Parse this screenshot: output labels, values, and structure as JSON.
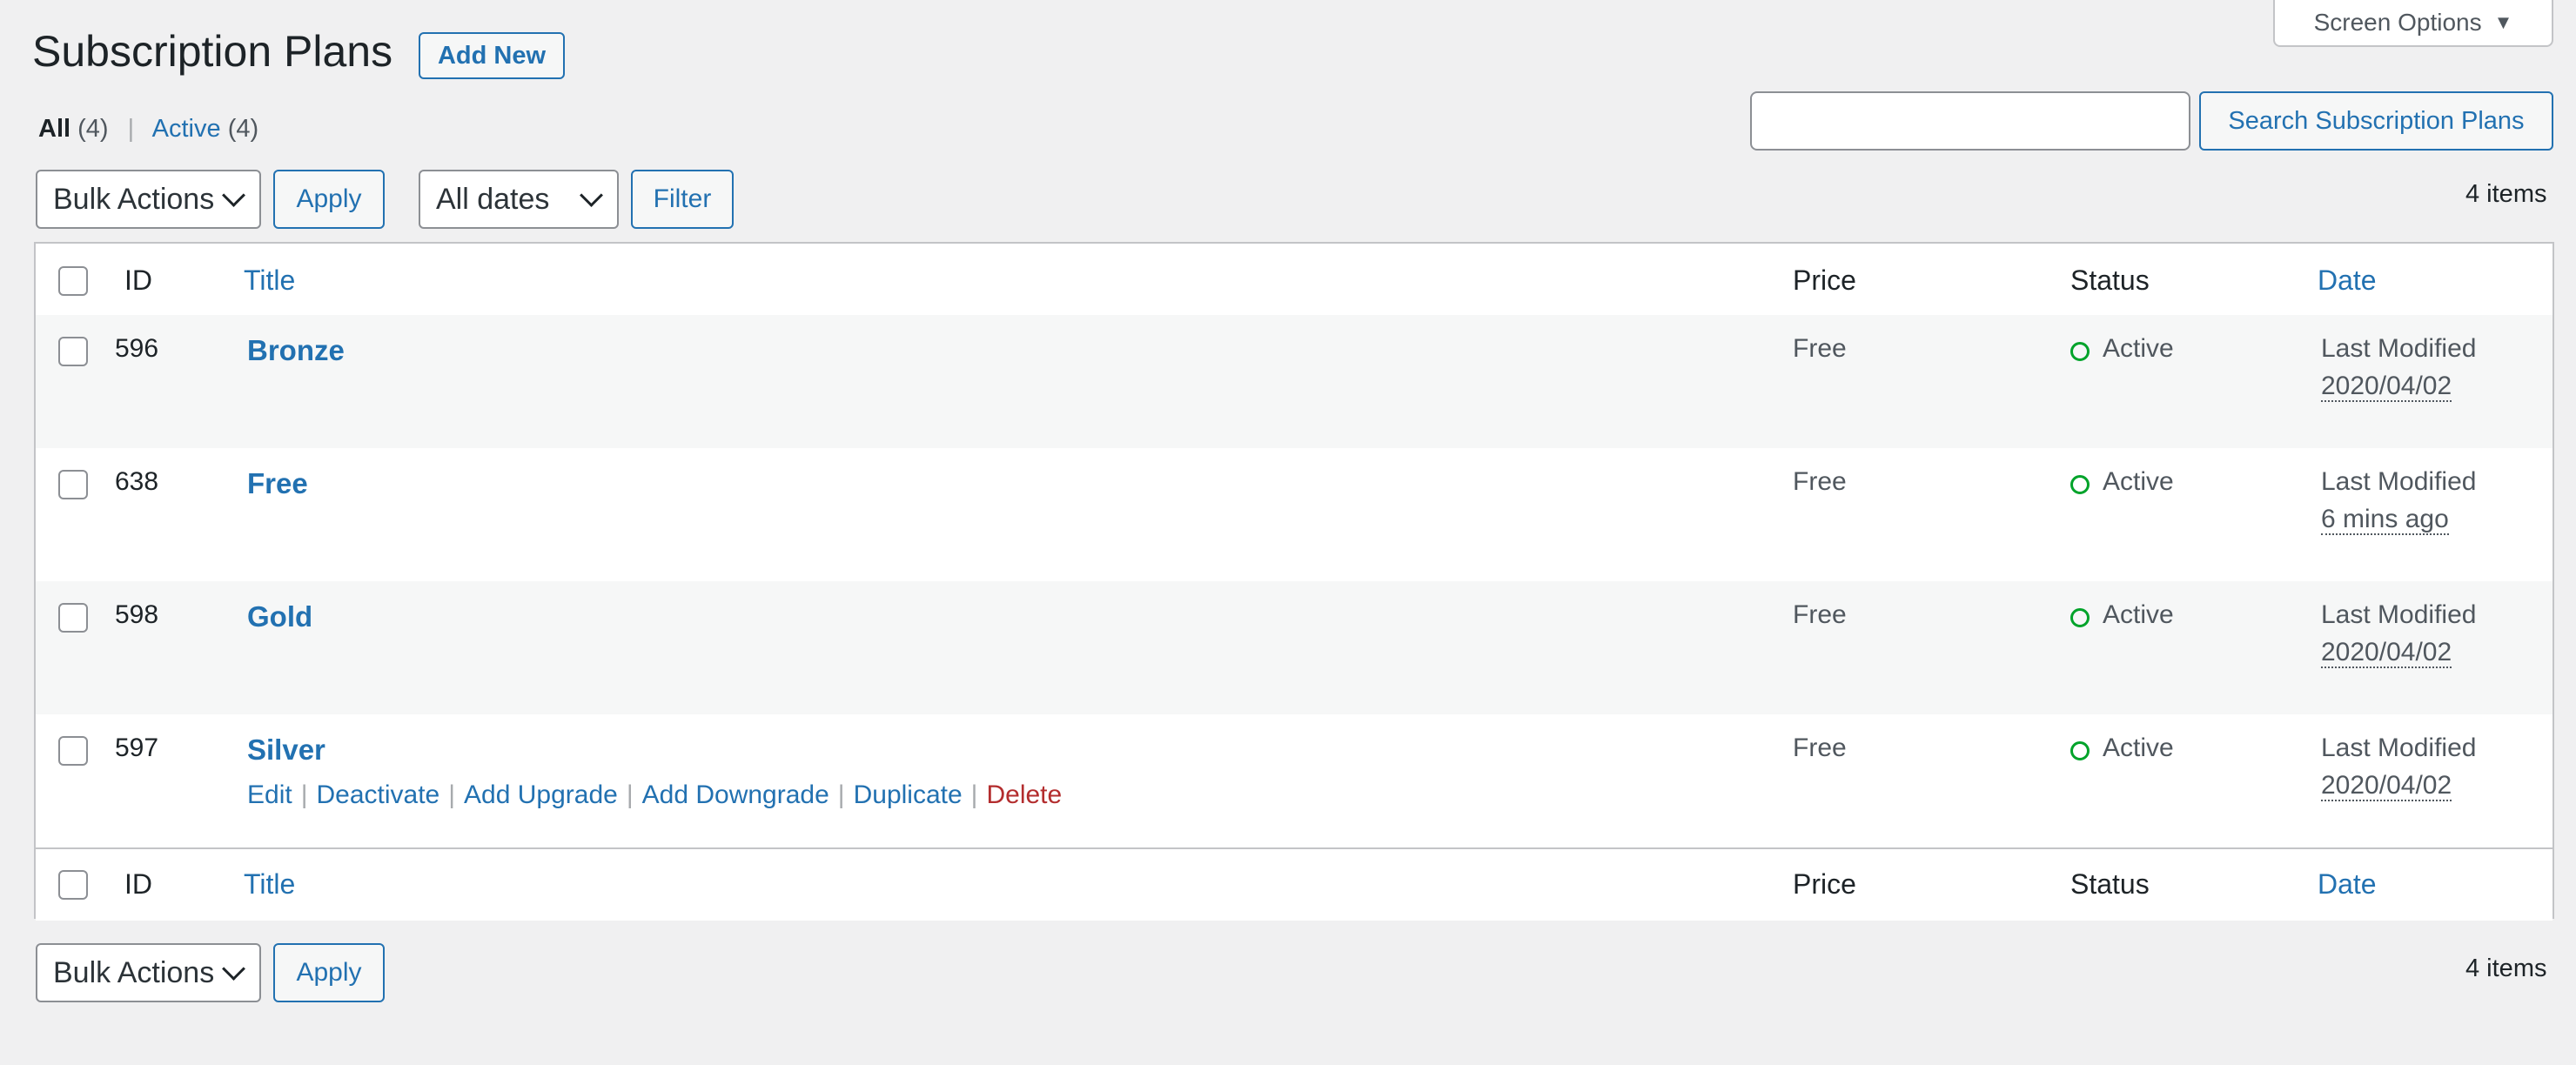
{
  "screen_options": {
    "label": "Screen Options",
    "icon": "triangle-down-icon"
  },
  "header": {
    "title": "Subscription Plans",
    "add_new_label": "Add New"
  },
  "views": {
    "all_label": "All",
    "all_count": "(4)",
    "separator": "|",
    "active_label": "Active",
    "active_count": "(4)"
  },
  "search": {
    "value": "",
    "button_label": "Search Subscription Plans"
  },
  "toolbar_top": {
    "bulk_actions": "Bulk Actions",
    "apply_label": "Apply",
    "date_filter": "All dates",
    "filter_label": "Filter",
    "items_count": "4 items"
  },
  "toolbar_bottom": {
    "bulk_actions": "Bulk Actions",
    "apply_label": "Apply",
    "items_count": "4 items"
  },
  "table": {
    "columns": {
      "id": "ID",
      "title": "Title",
      "price": "Price",
      "status": "Status",
      "date": "Date"
    },
    "rows": [
      {
        "id": "596",
        "title": "Bronze",
        "price": "Free",
        "status": "Active",
        "date_label": "Last Modified",
        "date_value": "2020/04/02"
      },
      {
        "id": "638",
        "title": "Free",
        "price": "Free",
        "status": "Active",
        "date_label": "Last Modified",
        "date_value": "6 mins ago"
      },
      {
        "id": "598",
        "title": "Gold",
        "price": "Free",
        "status": "Active",
        "date_label": "Last Modified",
        "date_value": "2020/04/02"
      },
      {
        "id": "597",
        "title": "Silver",
        "price": "Free",
        "status": "Active",
        "date_label": "Last Modified",
        "date_value": "2020/04/02"
      }
    ],
    "row_actions": {
      "edit": "Edit",
      "deactivate": "Deactivate",
      "add_upgrade": "Add Upgrade",
      "add_downgrade": "Add Downgrade",
      "duplicate": "Duplicate",
      "delete": "Delete",
      "separator": "|"
    }
  },
  "colors": {
    "link": "#2271b1",
    "active_status": "#00a32a",
    "delete": "#b32d2e",
    "background": "#f0f0f1"
  }
}
